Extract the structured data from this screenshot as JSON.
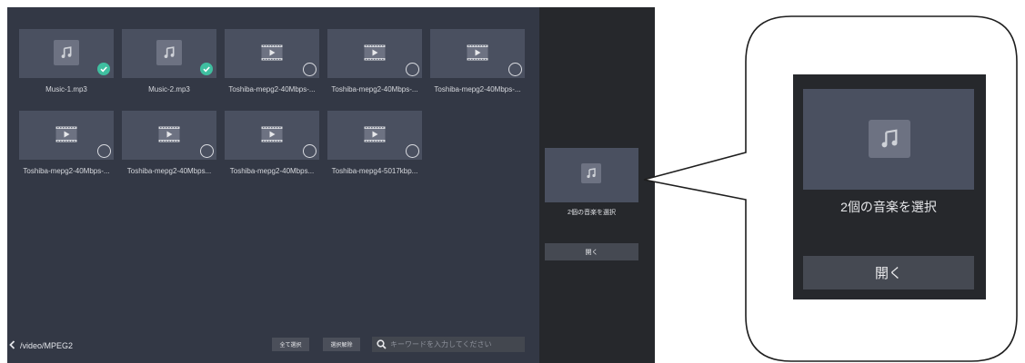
{
  "files": [
    {
      "name": "Music-1.mp3",
      "type": "music",
      "selected": true
    },
    {
      "name": "Music-2.mp3",
      "type": "music",
      "selected": true
    },
    {
      "name": "Toshiba-mepg2-40Mbps-...",
      "type": "video",
      "selected": false
    },
    {
      "name": "Toshiba-mepg2-40Mbps-...",
      "type": "video",
      "selected": false
    },
    {
      "name": "Toshiba-mepg2-40Mbps-...",
      "type": "video",
      "selected": false
    },
    {
      "name": "Toshiba-mepg2-40Mbps-...",
      "type": "video",
      "selected": false
    },
    {
      "name": "Toshiba-mepg2-40Mbps...",
      "type": "video",
      "selected": false
    },
    {
      "name": "Toshiba-mepg2-40Mbps...",
      "type": "video",
      "selected": false
    },
    {
      "name": "Toshiba-mepg4-5017kbp...",
      "type": "video",
      "selected": false
    }
  ],
  "bottom_bar": {
    "path": "/video/MPEG2",
    "select_all": "全て選択",
    "deselect": "選択解除",
    "search_placeholder": "キーワードを入力してください"
  },
  "side_panel": {
    "selection_text": "2個の音楽を選択",
    "open_button": "開く"
  },
  "callout": {
    "selection_text": "2個の音楽を選択",
    "open_button": "開く"
  },
  "colors": {
    "check_selected": "#3fbfa0",
    "panel_bg": "#26282c",
    "browser_bg": "#333845"
  },
  "icons": {
    "music": "music-note-icon",
    "video": "film-play-icon",
    "back": "chevron-left-icon",
    "search": "search-icon"
  }
}
